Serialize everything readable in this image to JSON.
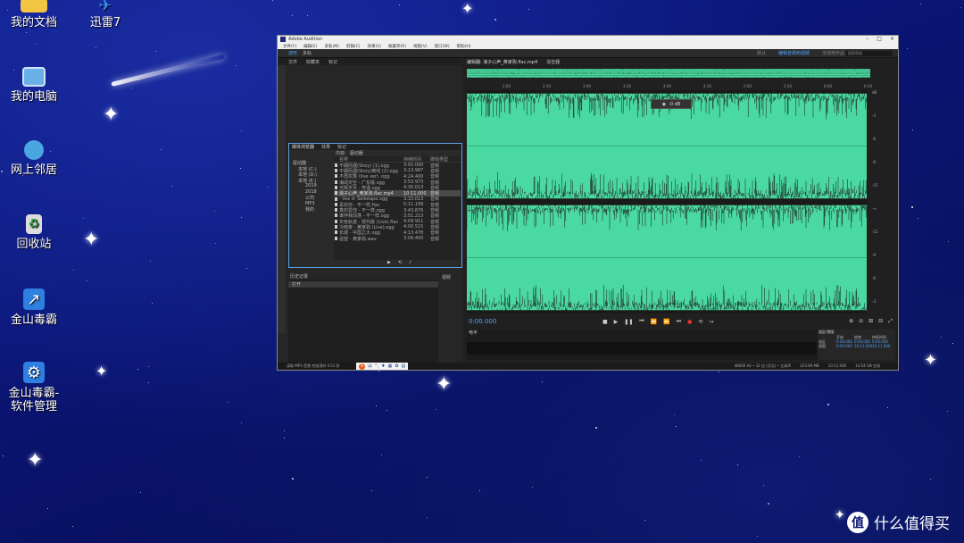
{
  "desktop": {
    "icons": [
      {
        "label": "我的文档",
        "icon": "folder-icon",
        "color": "#f4c542"
      },
      {
        "label": "迅雷7",
        "icon": "xunlei-icon",
        "color": "#3b8cf2"
      },
      {
        "label": "我的电脑",
        "icon": "computer-icon",
        "color": "#6ab0e8"
      },
      {
        "label": "网上邻居",
        "icon": "network-icon",
        "color": "#4aa6e0"
      },
      {
        "label": "回收站",
        "icon": "recycle-bin-icon",
        "color": "#dcdcdc"
      },
      {
        "label": "金山毒霸",
        "icon": "kingsoft-antivirus-icon",
        "color": "#2d7fe0"
      },
      {
        "label": "金山毒霸-\n软件管理",
        "icon": "kingsoft-software-manager-icon",
        "color": "#2d7fe0"
      }
    ],
    "watermark": "什么值得买"
  },
  "audition": {
    "title": "Adobe Audition",
    "window_controls": [
      "–",
      "□",
      "×"
    ],
    "menu": [
      "文件(F)",
      "编辑(E)",
      "多轨(M)",
      "剪辑(C)",
      "效果(S)",
      "收藏夹(R)",
      "视图(V)",
      "窗口(W)",
      "帮助(H)"
    ],
    "toolbar": {
      "mode1": "波形",
      "mode2": "多轨",
      "workspaces": [
        "默认",
        "编辑音频到视频",
        "无线电作品"
      ],
      "search_placeholder": "搜索帮助"
    },
    "left_tabs": [
      "文件",
      "收藏夹",
      "标记"
    ],
    "browser": {
      "tabs": [
        "媒体浏览器",
        "效果",
        "标记"
      ],
      "content_label": "内容:",
      "content_value": "驱动器",
      "tree": [
        "驱动器",
        "本地 (C:)",
        "本地 (D:)",
        "本地 (E:)",
        "2019",
        "2018",
        "公司",
        "MP3",
        "我的"
      ],
      "columns": [
        "名称",
        "持续时间",
        "媒体类型"
      ],
      "files": [
        {
          "name": "不期而遇(Shoy) (1).ogg",
          "dur": "3:02.000",
          "fmt": "音频"
        },
        {
          "name": "不期而遇(Shoy)离线 (2).ogg",
          "dur": "3:13.987",
          "fmt": "音频"
        },
        {
          "name": "不再犹豫 (live ver) .ogg",
          "dur": "4:24.400",
          "fmt": "音频"
        },
        {
          "name": "海阔天空 - 广东版.ogg",
          "dur": "3:53.973",
          "fmt": "音频"
        },
        {
          "name": "光辉岁月 - 粤语.ogg",
          "dur": "4:30.013",
          "fmt": "音频"
        },
        {
          "name": "浪子心声_黄家驹.flac.mp4",
          "dur": "10:11.000",
          "fmt": "音频"
        },
        {
          "name": "- live in Sellotape.ogg",
          "dur": "3:33.013",
          "fmt": "音频"
        },
        {
          "name": "喜欢你 - 不一样.flac",
          "dur": "5:11.199",
          "fmt": "音频"
        },
        {
          "name": "真的爱你 - 不一样.ogg",
          "dur": "3:43.876",
          "fmt": "音频"
        },
        {
          "name": "谁伴我闯荡 - 不一样.ogg",
          "dur": "3:51.213",
          "fmt": "音频"
        },
        {
          "name": "灰色轨迹 - 现代版 (Live).flac",
          "dur": "4:09.911",
          "fmt": "音频"
        },
        {
          "name": "冷雨夜 - 黄家驹 (Live).ogg",
          "dur": "4:00.515",
          "fmt": "音频"
        },
        {
          "name": "长城 - 中国之大.ogg",
          "dur": "4:13.478",
          "fmt": "音频"
        },
        {
          "name": "遥望 - 黄家驹.wav",
          "dur": "3:09.400",
          "fmt": "音频"
        }
      ]
    },
    "history": {
      "title": "历史记录",
      "row": "打开",
      "video": "视频"
    },
    "editor": {
      "tab": "编辑器: 浪子心声_黄家驹.flac.mp4",
      "tab2": "混音器",
      "ruler": [
        "2:00",
        "2:30",
        "3:00",
        "3:30",
        "4:00",
        "4:30",
        "5:00",
        "5:30",
        "6:00",
        "6:30",
        "7:00"
      ],
      "db": [
        "dB",
        "-3",
        "-6",
        "-9",
        "-15",
        "-∞",
        "-15",
        "-9",
        "-6",
        "-3"
      ],
      "zoom_hud": "-0 dB",
      "timecode": "0:00.000",
      "levels_title": "电平"
    },
    "waveform_color": "#4ad9a0",
    "selection": {
      "title": "选区/视图",
      "headers": [
        "开始",
        "结束",
        "持续时间"
      ],
      "rows": [
        {
          "label": "选区",
          "start": "0:00.000",
          "end": "0:00.000",
          "dur": "0:00.000"
        },
        {
          "label": "视图",
          "start": "0:00.000",
          "end": "10:11.000",
          "dur": "10:11.000"
        }
      ]
    },
    "status": {
      "left": "读取 MP3 音频 完成用时 4.51 秒",
      "sample": "48000 Hz • 32 位 (浮点) • 立体声",
      "size": "223.89 MB",
      "duration": "10:11.000",
      "free": "14.54 GB 空闲"
    }
  }
}
